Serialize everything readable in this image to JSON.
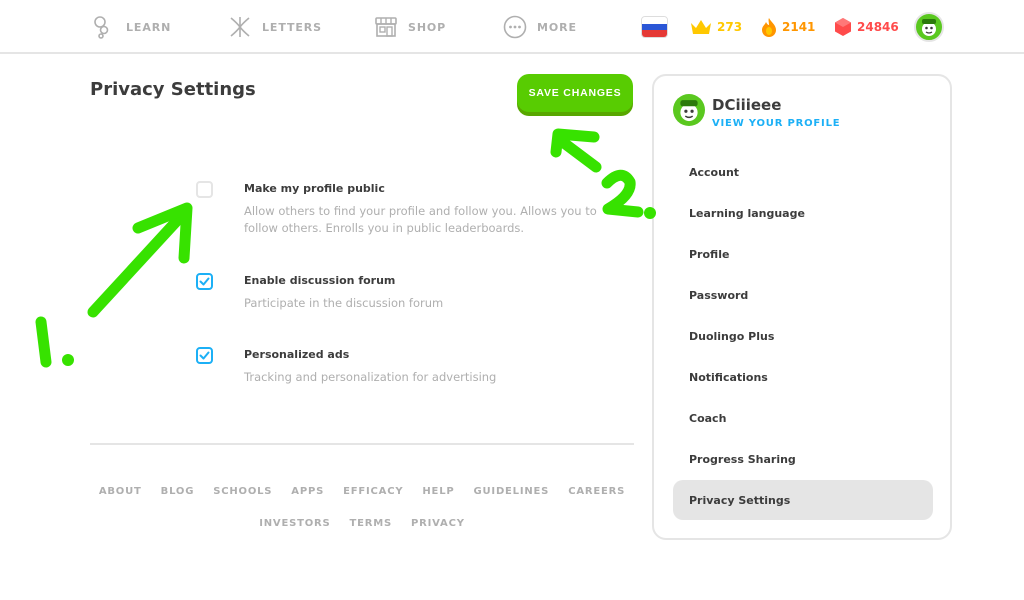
{
  "nav": {
    "items": [
      {
        "label": "LEARN",
        "icon": "learn-icon"
      },
      {
        "label": "LETTERS",
        "icon": "letters-icon"
      },
      {
        "label": "SHOP",
        "icon": "shop-icon"
      },
      {
        "label": "MORE",
        "icon": "more-icon"
      }
    ],
    "flag": "russia-flag-icon",
    "crowns": "273",
    "streak": "2141",
    "gems": "24846"
  },
  "colors": {
    "accent_green": "#58cc02",
    "link_blue": "#1cb0f6",
    "crown_gold": "#ffc800",
    "streak_orange": "#ff9600",
    "gem_red": "#ff4b4b",
    "annotation_green": "#37e200"
  },
  "main": {
    "title": "Privacy Settings",
    "save_label": "SAVE CHANGES",
    "settings": [
      {
        "title": "Make my profile public",
        "desc": "Allow others to find your profile and follow you. Allows you to follow others. Enrolls you in public leaderboards.",
        "checked": false
      },
      {
        "title": "Enable discussion forum",
        "desc": "Participate in the discussion forum",
        "checked": true
      },
      {
        "title": "Personalized ads",
        "desc": "Tracking and personalization for advertising",
        "checked": true
      }
    ]
  },
  "footer": {
    "row1": [
      "ABOUT",
      "BLOG",
      "SCHOOLS",
      "APPS",
      "EFFICACY",
      "HELP",
      "GUIDELINES",
      "CAREERS"
    ],
    "row2": [
      "INVESTORS",
      "TERMS",
      "PRIVACY"
    ]
  },
  "panel": {
    "username": "DCiiieee",
    "view_profile": "VIEW YOUR PROFILE",
    "menu": [
      "Account",
      "Learning language",
      "Profile",
      "Password",
      "Duolingo Plus",
      "Notifications",
      "Coach",
      "Progress Sharing",
      "Privacy Settings"
    ],
    "active": "Privacy Settings"
  },
  "annotations": {
    "label_1": "1.",
    "label_2": "2."
  }
}
